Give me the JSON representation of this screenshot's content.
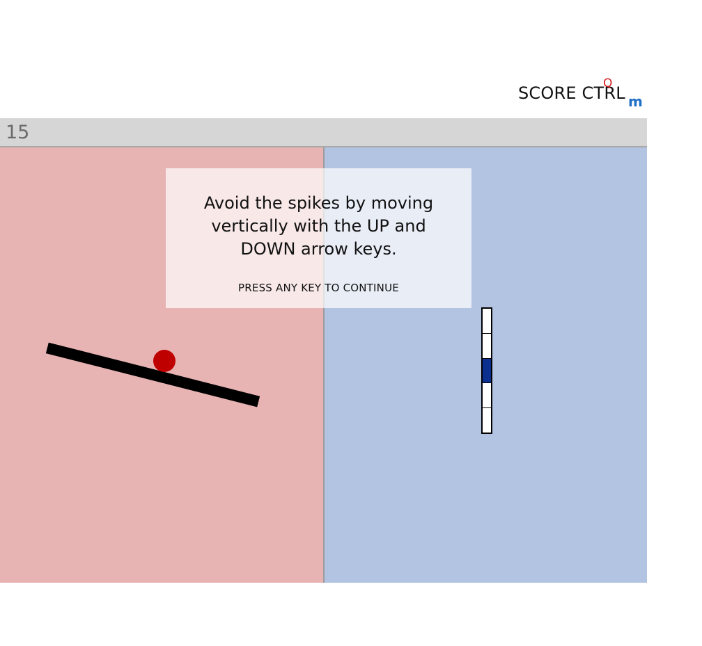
{
  "logo": {
    "text": "SCORE CTRL",
    "superscript": "Q",
    "subscript": "m"
  },
  "header": {
    "counter": "15"
  },
  "overlay": {
    "instruction": "Avoid the spikes by moving vertically with the UP and DOWN arrow keys.",
    "continue_prompt": "PRESS ANY KEY TO CONTINUE"
  },
  "gauge": {
    "segments": 5,
    "active_segment": 3
  },
  "colors": {
    "left_panel": "#e8b3b3",
    "right_panel": "#b3c3e2",
    "ball": "#bf0000",
    "gauge_active": "#0a2f8f",
    "logo_q": "#d81e1e",
    "logo_m": "#1f6fc6"
  }
}
